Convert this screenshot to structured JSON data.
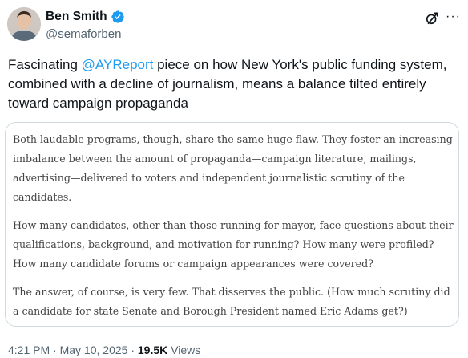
{
  "author": {
    "name": "Ben Smith",
    "handle": "@semaforben",
    "avatar_icon": "avatar-photo",
    "verified_icon": "verified-badge-icon"
  },
  "header_actions": {
    "grok_icon": "grok-icon",
    "more_label": "···"
  },
  "tweet": {
    "text_before": "Fascinating ",
    "mention": "@AYReport",
    "text_after": " piece on how New York's public funding system, combined with a decline of journalism, means a balance tilted entirely toward campaign propaganda"
  },
  "quote_image": {
    "paragraphs": [
      "Both laudable programs, though, share the same huge flaw. They foster an increasing imbalance between the amount of propaganda—campaign literature, mailings, advertising—delivered to voters and independent journalistic scrutiny of the candidates.",
      "How many candidates, other than those running for mayor, face questions about their qualifications, background, and motivation for running? How many were profiled? How many candidate forums or campaign appearances were covered?",
      "The answer, of course, is very few. That disserves the public. (How much scrutiny did a candidate for state Senate and Borough President named Eric Adams get?)"
    ]
  },
  "meta": {
    "time": "4:21 PM",
    "separator": " · ",
    "date": "May 10, 2025",
    "views_count": "19.5K",
    "views_label": " Views"
  },
  "colors": {
    "link": "#1d9bf0",
    "verified": "#1d9bf0",
    "secondary_text": "#536471",
    "border": "#cfd9de"
  }
}
